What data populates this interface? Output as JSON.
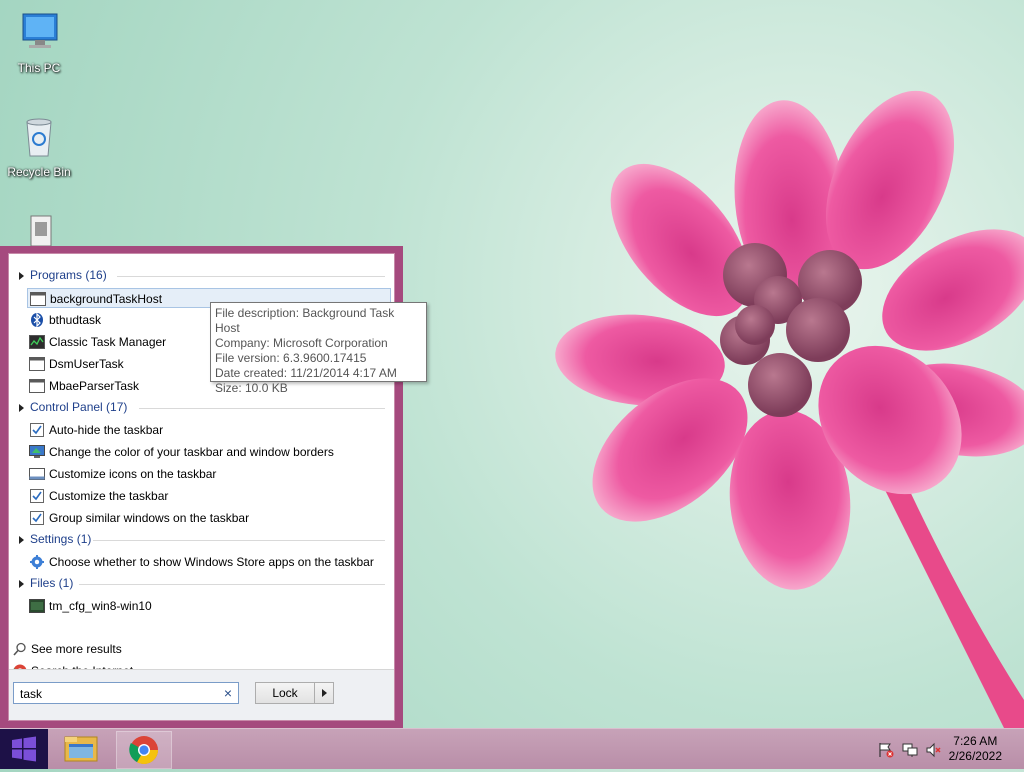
{
  "desktop": {
    "icons": [
      {
        "label": "This PC",
        "icon": "this-pc-icon"
      },
      {
        "label": "Recycle Bin",
        "icon": "recycle-bin-icon"
      }
    ]
  },
  "menu": {
    "categories": {
      "programs": "Programs (16)",
      "control_panel": "Control Panel (17)",
      "settings": "Settings (1)",
      "files": "Files (1)"
    },
    "programs": [
      "backgroundTaskHost",
      "bthudtask",
      "Classic Task Manager",
      "DsmUserTask",
      "MbaeParserTask"
    ],
    "control_panel": [
      "Auto-hide the taskbar",
      "Change the color of your taskbar and window borders",
      "Customize icons on the taskbar",
      "Customize the taskbar",
      "Group similar windows on the taskbar"
    ],
    "settings": [
      "Choose whether to show Windows Store apps on the taskbar"
    ],
    "files": [
      "tm_cfg_win8-win10"
    ],
    "see_more": "See more results",
    "search_internet": "Search the Internet",
    "search_value": "task",
    "lock_label": "Lock"
  },
  "tooltip": {
    "description": "File description: Background Task Host",
    "company": "Company: Microsoft Corporation",
    "version": "File version: 6.3.9600.17415",
    "created": "Date created: 11/21/2014 4:17 AM",
    "size": "Size: 10.0 KB"
  },
  "taskbar": {
    "time": "7:26 AM",
    "date": "2/26/2022"
  },
  "colors": {
    "menu_border": "#a54a7e",
    "selection": "#e5eef8",
    "category_text": "#1e3f8a",
    "start_button": "#1d1147"
  }
}
